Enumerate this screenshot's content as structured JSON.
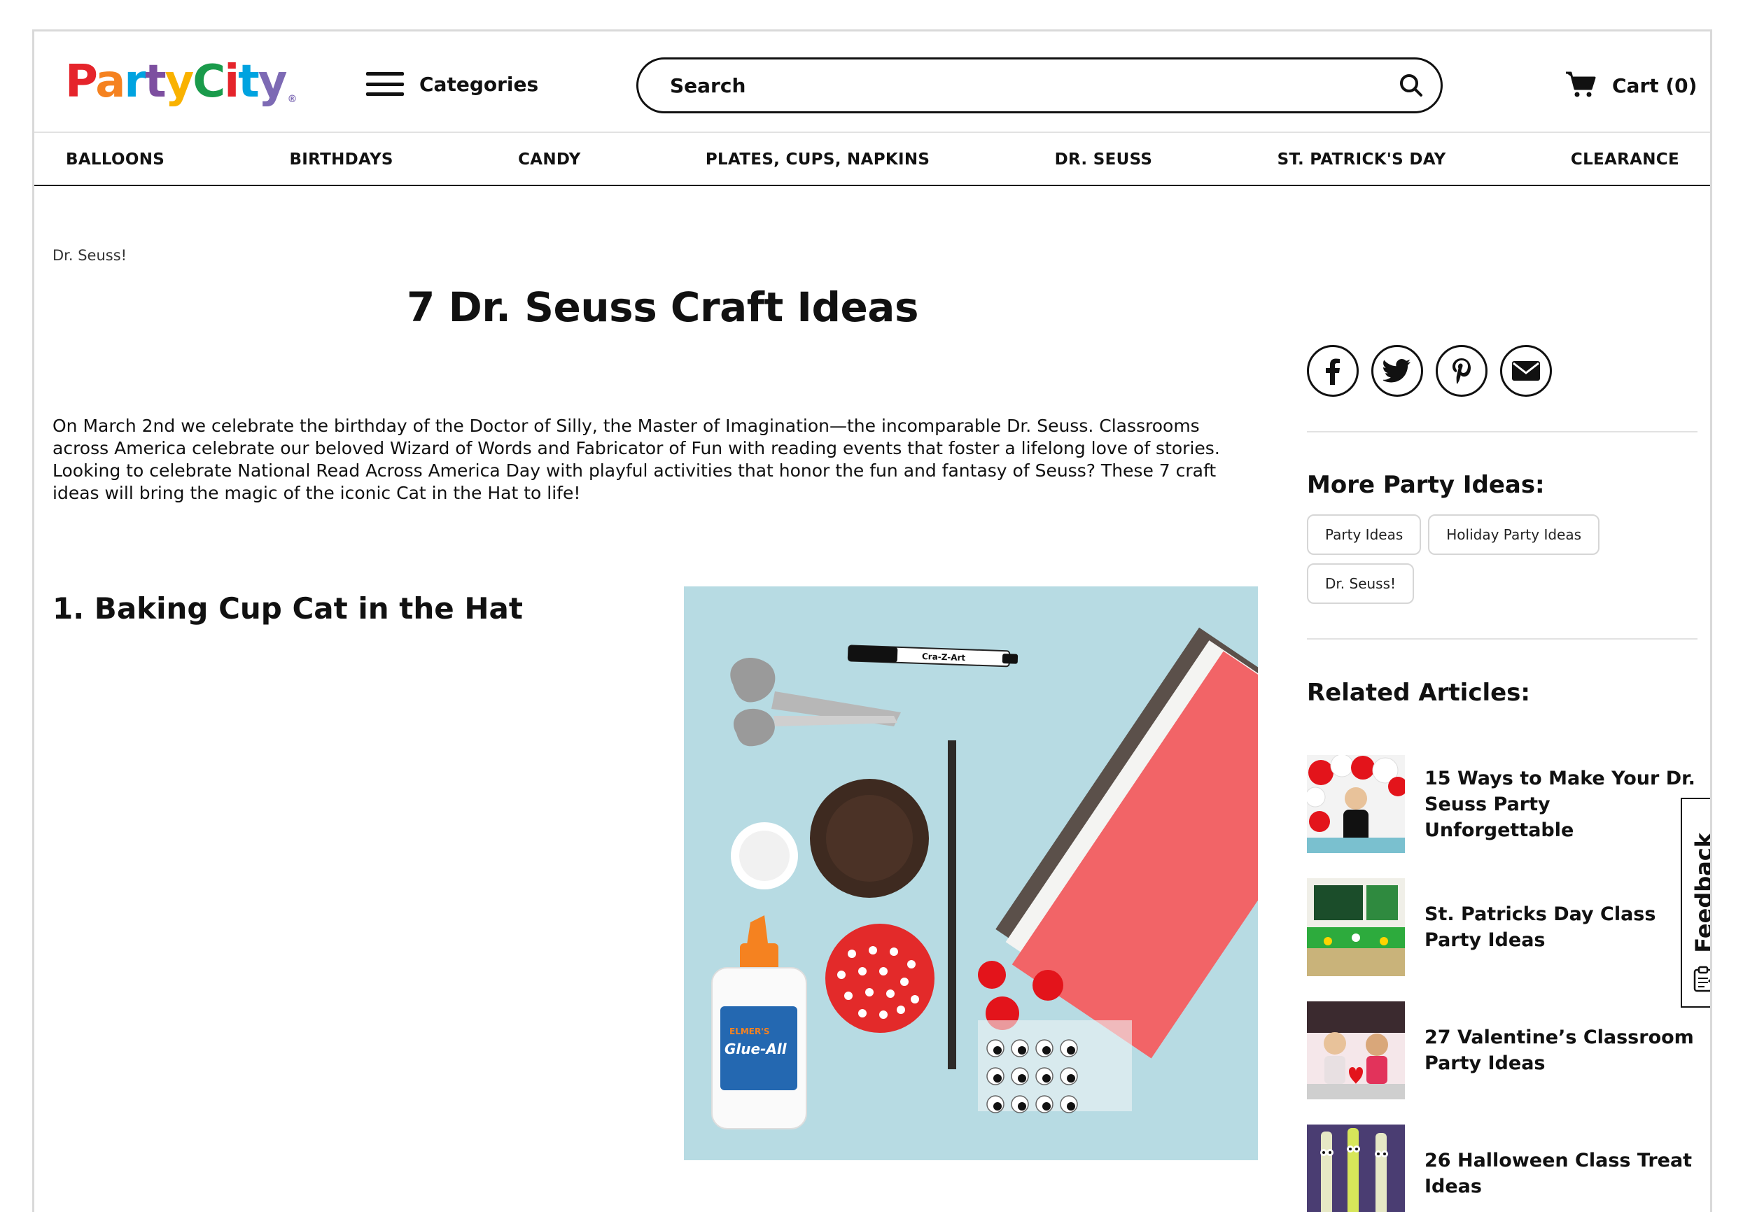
{
  "header": {
    "logo": {
      "party": "Party",
      "city": "City",
      "tm": "®"
    },
    "categories_label": "Categories",
    "search_placeholder": "Search",
    "cart_label": "Cart (0)"
  },
  "nav": [
    "BALLOONS",
    "BIRTHDAYS",
    "CANDY",
    "PLATES, CUPS, NAPKINS",
    "DR. SEUSS",
    "ST. PATRICK'S DAY",
    "CLEARANCE"
  ],
  "breadcrumb": "Dr. Seuss!",
  "article": {
    "title": "7 Dr. Seuss Craft Ideas",
    "intro": "On March 2nd we celebrate the birthday of the Doctor of Silly, the Master of Imagination—the incomparable Dr. Seuss. Classrooms across America celebrate our beloved Wizard of Words and Fabricator of Fun with reading events that foster a lifelong love of stories. Looking to celebrate National Read Across America Day with playful activities that honor the fun and fantasy of Seuss? These 7 craft ideas will bring the magic of the iconic Cat in the Hat to life!",
    "section1_heading": "1. Baking Cup Cat in the Hat",
    "image_labels": {
      "marker": "Cra-Z-Art",
      "glue_brand": "ELMER'S",
      "glue_name": "Glue-All"
    }
  },
  "sidebar": {
    "share_icons": [
      "facebook-icon",
      "twitter-icon",
      "pinterest-icon",
      "email-icon"
    ],
    "more_heading": "More Party Ideas:",
    "chips": [
      "Party Ideas",
      "Holiday Party Ideas",
      "Dr. Seuss!"
    ],
    "related_heading": "Related Articles:",
    "related": [
      {
        "title": "15 Ways to Make Your Dr. Seuss Party Unforgettable"
      },
      {
        "title": "St. Patricks Day Class Party Ideas"
      },
      {
        "title": "27 Valentine’s Classroom Party Ideas"
      },
      {
        "title": "26 Halloween Class Treat Ideas"
      }
    ]
  },
  "feedback_label": "Feedback",
  "colors": {
    "logo_p": "#e5242b",
    "logo_a": "#f58220",
    "logo_r": "#00a3e0",
    "logo_t": "#7d4fa0",
    "logo_y": "#f9b200",
    "logo_c": "#1a9b4b",
    "logo_i": "#e5242b",
    "logo_t2": "#00a3e0",
    "logo_y2": "#7d6ab4",
    "image_bg": "#b7dbe3",
    "paper_red": "#f26467"
  }
}
